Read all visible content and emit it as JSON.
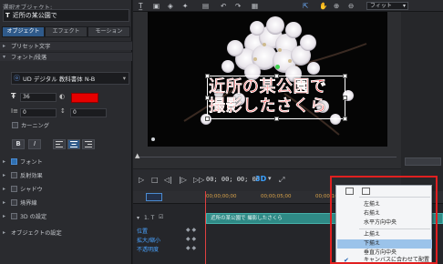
{
  "left_panel": {
    "header": "選択オブジェクト:",
    "object_name": "近所の某公園で",
    "tabs": [
      "オブジェクト",
      "エフェクト",
      "モーション"
    ],
    "section_preset": "プリセット文字",
    "section_font": "フォント/段落",
    "font_name": "UD デジタル 教科書体 N-B",
    "font_size": "36",
    "spacing_value": "0",
    "line_value": "0",
    "kerning": "カーニング",
    "font_color": "#e60000",
    "bold_label": "B",
    "italic_label": "I",
    "sections": [
      {
        "label": "フォント",
        "checked": true
      },
      {
        "label": "反射効果",
        "checked": false
      },
      {
        "label": "シャドウ",
        "checked": false
      },
      {
        "label": "境界線",
        "checked": false
      },
      {
        "label": "3D の設定",
        "checked": false
      },
      {
        "label": "オブジェクトの設定",
        "checked": false
      }
    ]
  },
  "toolbar": {
    "fit_label": "フィット"
  },
  "preview": {
    "caption_line1": "近所の某公園で",
    "caption_line2": "撮影したさくら"
  },
  "controls": {
    "timecode": "00; 00; 00; 00",
    "label_3d": "3D"
  },
  "timeline": {
    "ruler": [
      "00;00;00;00",
      "00;00;05;00",
      "00;00;10;00"
    ],
    "ruler_right": "00;30;10",
    "track_label": "1. T",
    "clip_text": "近所の某公園で 撮影したさくら",
    "props": [
      "位置",
      "拡大/縮小",
      "不透明度"
    ]
  },
  "menu": {
    "items": [
      {
        "label": "左揃え",
        "selected": false
      },
      {
        "label": "右揃え",
        "selected": false
      },
      {
        "label": "水平方向中央",
        "selected": false
      },
      {
        "label": "上揃え",
        "selected": false
      },
      {
        "label": "下揃え",
        "selected": true
      },
      {
        "label": "垂直方向中央",
        "selected": false
      },
      {
        "label": "キャンバスに合わせて配置",
        "selected": false,
        "checked": true
      }
    ]
  }
}
